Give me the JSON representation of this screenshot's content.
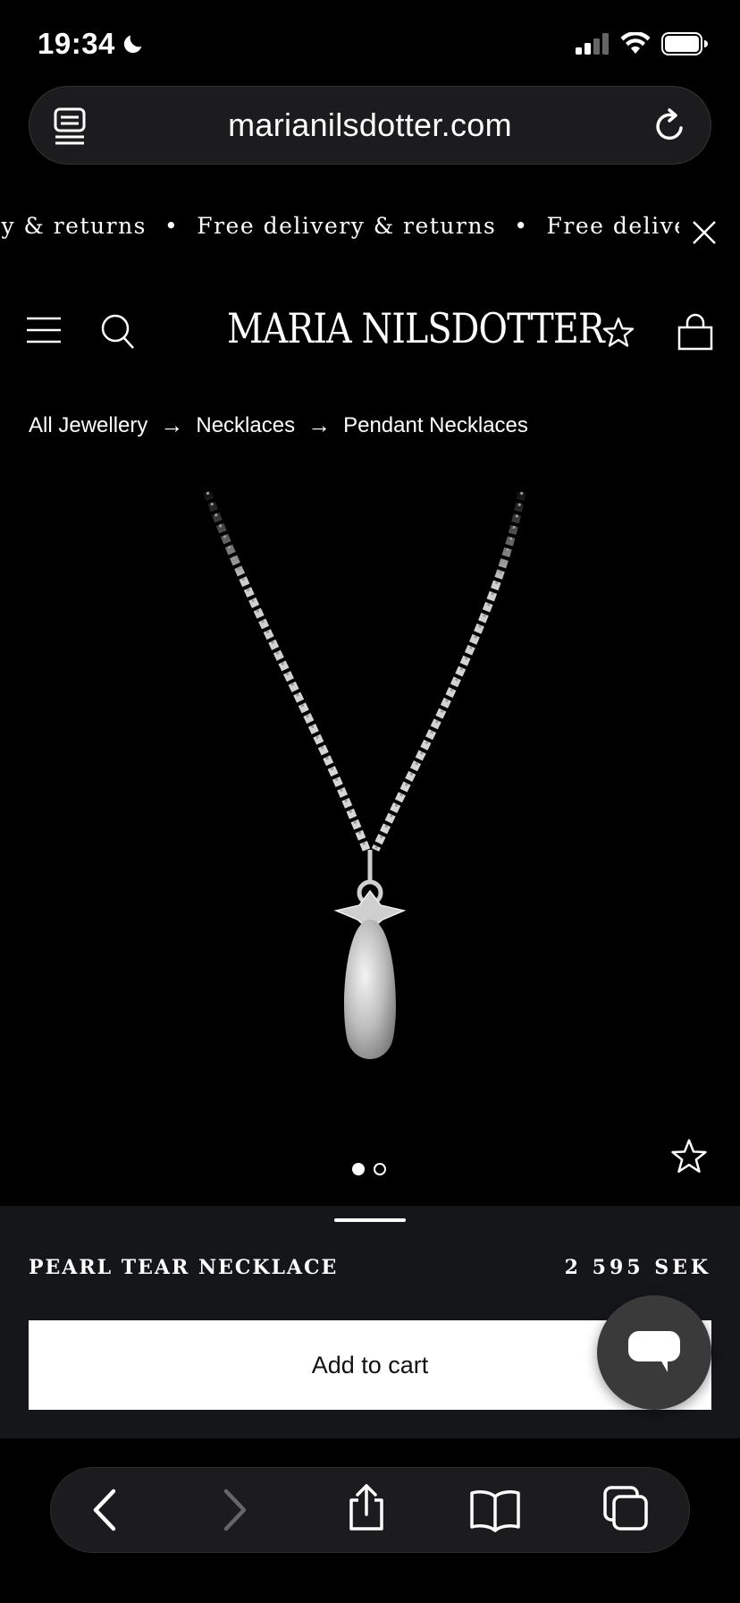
{
  "status": {
    "time": "19:34"
  },
  "browser": {
    "url": "marianilsdotter.com"
  },
  "announcement": {
    "text_partial": "ry & returns",
    "text_1": "Free delivery & returns",
    "text_2": "Free delivery"
  },
  "header": {
    "logo": "MARIA NILSDOTTER"
  },
  "breadcrumb": {
    "items": [
      "All Jewellery",
      "Necklaces",
      "Pendant Necklaces"
    ],
    "separator": "→"
  },
  "product": {
    "name": "PEARL TEAR NECKLACE",
    "price": "2 595 SEK",
    "add_to_cart": "Add to cart",
    "image_count": 2,
    "current_image": 1
  },
  "colors": {
    "background": "#000000",
    "panel": "#15161a",
    "button": "#ffffff"
  }
}
